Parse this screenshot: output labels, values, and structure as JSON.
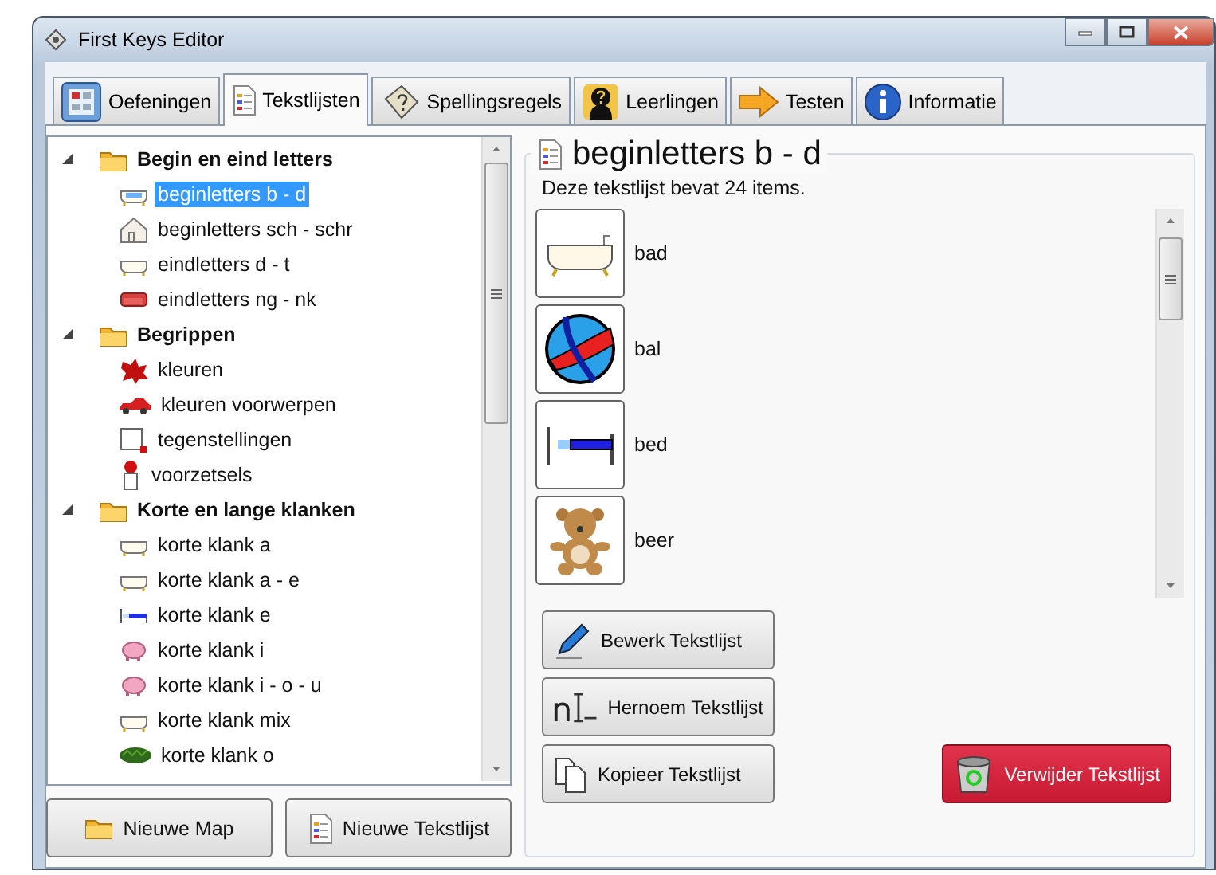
{
  "window": {
    "title": "First Keys Editor"
  },
  "tabs": [
    {
      "label": "Oefeningen",
      "selected": false
    },
    {
      "label": "Tekstlijsten",
      "selected": true
    },
    {
      "label": "Spellingsregels",
      "selected": false
    },
    {
      "label": "Leerlingen",
      "selected": false
    },
    {
      "label": "Testen",
      "selected": false
    },
    {
      "label": "Informatie",
      "selected": false
    }
  ],
  "tree": [
    {
      "label": "Begin en eind letters",
      "expanded": true,
      "children": [
        {
          "label": "beginletters b - d",
          "selected": true
        },
        {
          "label": "beginletters sch - schr",
          "selected": false
        },
        {
          "label": "eindletters d - t",
          "selected": false
        },
        {
          "label": "eindletters ng - nk",
          "selected": false
        }
      ]
    },
    {
      "label": "Begrippen",
      "expanded": true,
      "children": [
        {
          "label": "kleuren",
          "selected": false
        },
        {
          "label": "kleuren voorwerpen",
          "selected": false
        },
        {
          "label": "tegenstellingen",
          "selected": false
        },
        {
          "label": "voorzetsels",
          "selected": false
        }
      ]
    },
    {
      "label": "Korte en lange klanken",
      "expanded": true,
      "children": [
        {
          "label": "korte klank a",
          "selected": false
        },
        {
          "label": "korte klank a - e",
          "selected": false
        },
        {
          "label": "korte klank e",
          "selected": false
        },
        {
          "label": "korte klank i",
          "selected": false
        },
        {
          "label": "korte klank i - o - u",
          "selected": false
        },
        {
          "label": "korte klank mix",
          "selected": false
        },
        {
          "label": "korte klank o",
          "selected": false
        }
      ]
    }
  ],
  "left_buttons": [
    "Nieuwe Map",
    "Nieuwe Tekstlijst"
  ],
  "detail": {
    "title": "beginletters b - d",
    "description": "Deze tekstlijst bevat 24 items.",
    "items": [
      "bad",
      "bal",
      "bed",
      "beer"
    ],
    "buttons": [
      {
        "label": "Bewerk Tekstlijst",
        "kind": "normal"
      },
      {
        "label": "Hernoem Tekstlijst",
        "kind": "normal"
      },
      {
        "label": "Kopieer Tekstlijst",
        "kind": "normal"
      },
      {
        "label": "Verwijder Tekstlijst",
        "kind": "danger"
      }
    ]
  }
}
